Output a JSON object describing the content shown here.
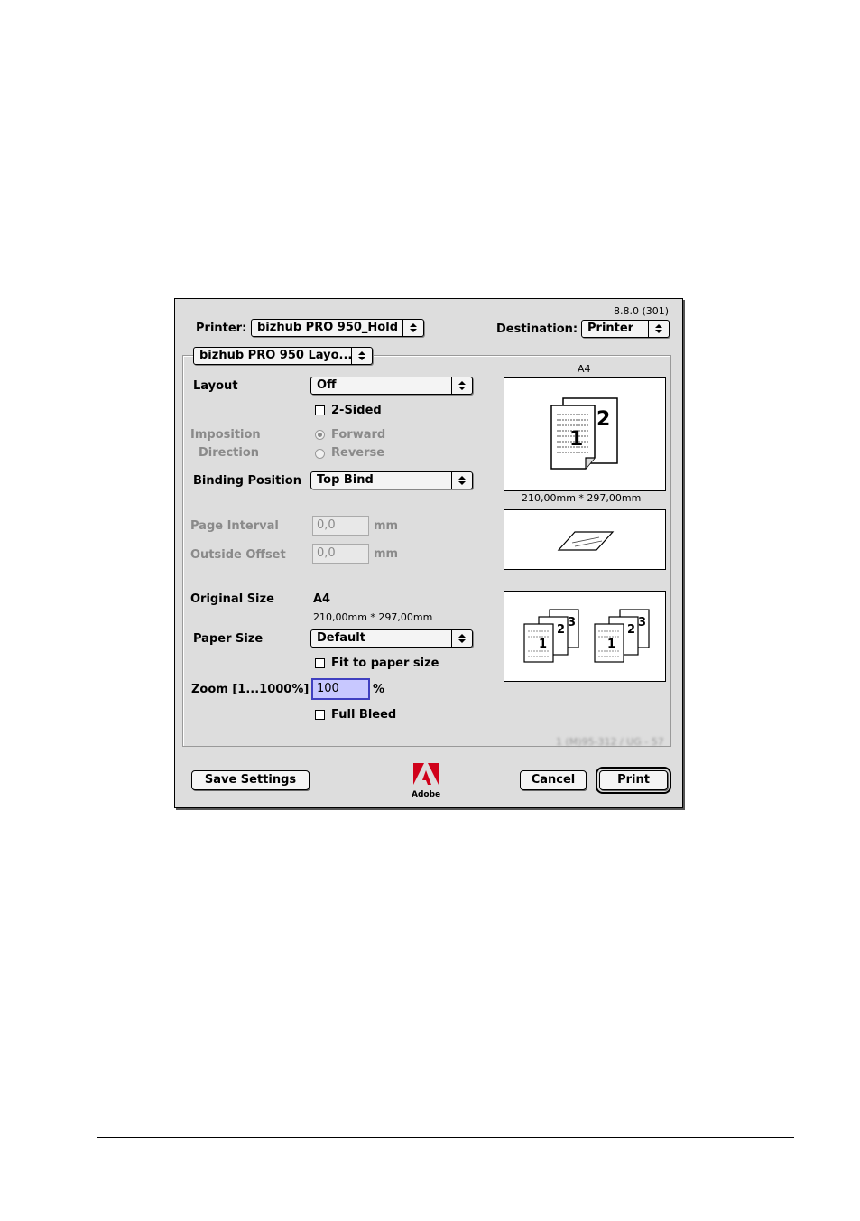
{
  "dialog": {
    "version": "8.8.0 (301)",
    "printer_label": "Printer:",
    "printer_value": "bizhub PRO 950_Hold",
    "destination_label": "Destination:",
    "destination_value": "Printer",
    "panel_menu": "bizhub PRO 950 Layo...",
    "paper_name": "A4",
    "paper_dims": "210,00mm * 297,00mm",
    "layout_label": "Layout",
    "layout_value": "Off",
    "two_sided_label": "2-Sided",
    "two_sided_checked": false,
    "imposition_label": "Imposition",
    "direction_label": "Direction",
    "forward_label": "Forward",
    "reverse_label": "Reverse",
    "binding_label": "Binding Position",
    "binding_value": "Top Bind",
    "page_interval_label": "Page Interval",
    "page_interval_value": "0,0",
    "outside_offset_label": "Outside Offset",
    "outside_offset_value": "0,0",
    "mm": "mm",
    "original_size_label": "Original Size",
    "original_size_value": "A4",
    "original_size_dims": "210,00mm * 297,00mm",
    "paper_size_label": "Paper Size",
    "paper_size_value": "Default",
    "fit_label": "Fit to paper size",
    "zoom_label": "Zoom [1...1000%]",
    "zoom_value": "100",
    "percent": "%",
    "full_bleed_label": "Full Bleed",
    "blurred_text": "1 (M)95-312 / UG - 57",
    "save_button": "Save Settings",
    "cancel_button": "Cancel",
    "print_button": "Print",
    "logo_text": "Adobe"
  }
}
